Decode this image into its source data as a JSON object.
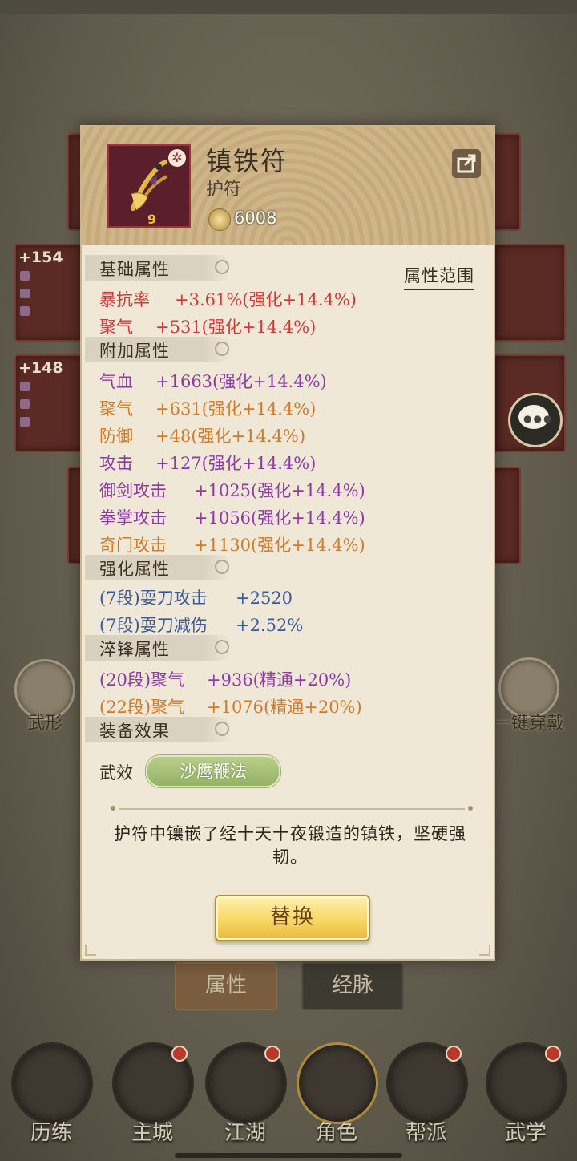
{
  "background": {
    "slots_left": [
      "+154",
      "+148"
    ],
    "side_left_label": "武形",
    "side_right_label": "一键穿戴",
    "tabs": [
      "属性",
      "经脉"
    ],
    "nav": [
      "历练",
      "主城",
      "江湖",
      "角色",
      "帮派",
      "武学"
    ]
  },
  "item": {
    "name": "镇铁符",
    "type": "护符",
    "score": "6008",
    "badge": "✲",
    "star": "9",
    "share_icon": "share-icon"
  },
  "sections": {
    "base": "基础属性",
    "extra": "附加属性",
    "enhance": "强化属性",
    "temper": "淬锋属性",
    "effect": "装备效果"
  },
  "attr_range": "属性范围",
  "base_attrs": [
    {
      "k": "暴抗率",
      "v": "+3.61%(强化+14.4%)"
    },
    {
      "k": "聚气",
      "v": "+531(强化+14.4%)"
    }
  ],
  "extra_attrs": [
    {
      "k": "气血",
      "v": "+1663(强化+14.4%)"
    },
    {
      "k": "聚气",
      "v": "+631(强化+14.4%)"
    },
    {
      "k": "防御",
      "v": "+48(强化+14.4%)"
    },
    {
      "k": "攻击",
      "v": "+127(强化+14.4%)"
    },
    {
      "k": "御剑攻击",
      "v": "+1025(强化+14.4%)"
    },
    {
      "k": "拳掌攻击",
      "v": "+1056(强化+14.4%)"
    },
    {
      "k": "奇门攻击",
      "v": "+1130(强化+14.4%)"
    }
  ],
  "enhance_attrs": [
    {
      "k": "(7段)耍刀攻击",
      "v": "+2520"
    },
    {
      "k": "(7段)耍刀减伤",
      "v": "+2.52%"
    }
  ],
  "temper_attrs": [
    {
      "k": "(20段)聚气",
      "v": "+936(精通+20%)"
    },
    {
      "k": "(22段)聚气",
      "v": "+1076(精通+20%)"
    }
  ],
  "effect": {
    "label": "武效",
    "value": "沙鹰鞭法"
  },
  "description": "护符中镶嵌了经十天十夜锻造的镇铁，坚硬强韧。",
  "replace_button": "替换",
  "colors": {
    "red": "#d23a3a",
    "purple": "#8e3aa6",
    "orange": "#d07a2c",
    "blue": "#3a5a9e"
  }
}
